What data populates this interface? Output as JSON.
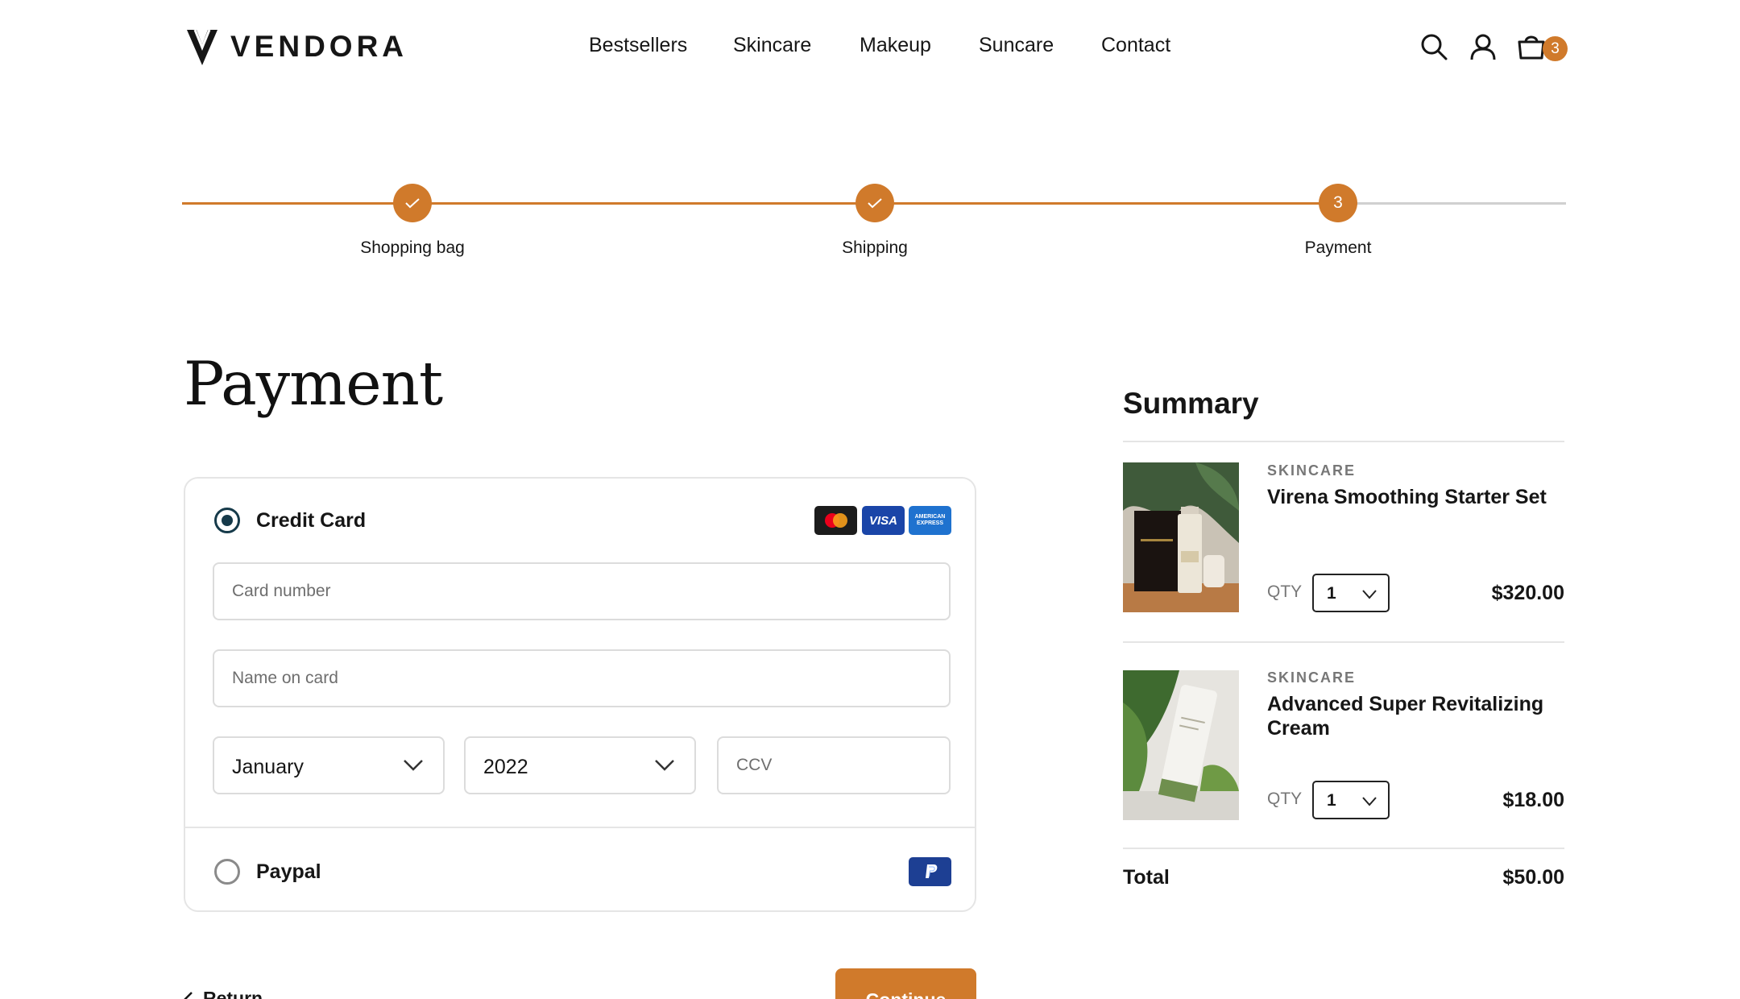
{
  "brand": {
    "name": "VENDORA"
  },
  "nav": {
    "items": [
      "Bestsellers",
      "Skincare",
      "Makeup",
      "Suncare",
      "Contact"
    ]
  },
  "header": {
    "cart_count": "3"
  },
  "stepper": {
    "steps": [
      {
        "label": "Shopping bag",
        "state": "done"
      },
      {
        "label": "Shipping",
        "state": "done"
      },
      {
        "label": "Payment",
        "state": "current",
        "number": "3"
      }
    ]
  },
  "payment": {
    "title": "Payment",
    "credit_card": {
      "label": "Credit Card",
      "selected": true,
      "card_number_placeholder": "Card number",
      "name_placeholder": "Name on card",
      "month_value": "January",
      "year_value": "2022",
      "ccv_placeholder": "CCV",
      "brands": {
        "visa": "VISA",
        "amex": "AMERICAN EXPRESS"
      }
    },
    "paypal": {
      "label": "Paypal",
      "selected": false
    },
    "return_label": "Return",
    "continue_label": "Continue"
  },
  "summary": {
    "title": "Summary",
    "qty_label": "QTY",
    "items": [
      {
        "category": "SKINCARE",
        "name": "Virena Smoothing Starter Set",
        "qty": "1",
        "price": "$320.00"
      },
      {
        "category": "SKINCARE",
        "name": "Advanced Super Revitalizing Cream",
        "qty": "1",
        "price": "$18.00"
      }
    ],
    "total_label": "Total",
    "total_value": "$50.00"
  },
  "colors": {
    "accent": "#d07a2b",
    "radio_selected": "#163a4a",
    "border": "#e5e5e5",
    "visa": "#1a45a8",
    "amex": "#1f72cf",
    "paypal": "#1d3f93"
  }
}
